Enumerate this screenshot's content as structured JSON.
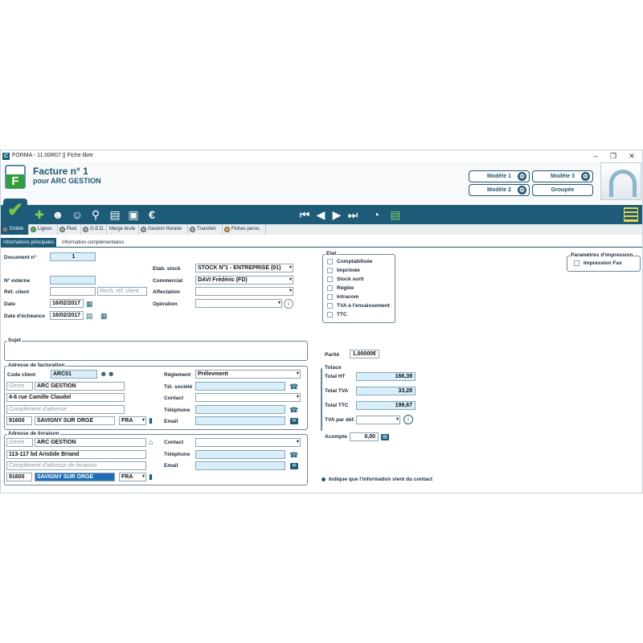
{
  "window": {
    "title": "FORMA - 11.00R07 || Fiche libre",
    "icon": "C"
  },
  "header": {
    "title": "Facture n° 1",
    "subtitle": "pour ARC GESTION",
    "logo_letter": "F"
  },
  "models": {
    "m1": "Modèle 1",
    "m2": "Modèle 2",
    "m3": "Modèle 3",
    "grouped": "Groupée"
  },
  "toolbar": {
    "euro": "€"
  },
  "tabs": [
    "Entête",
    "Lignes",
    "Pied",
    "G.E.D.",
    "Marge brute",
    "Gestion Horaire",
    "Transfert",
    "Fiches perso."
  ],
  "subtabs": [
    "Informations principales",
    "Information complémentaires"
  ],
  "form": {
    "document_label": "Document n°",
    "document_value": "1",
    "ext_label": "N° externe",
    "ext_value": "",
    "ref_label": "Réf. client",
    "ref_value": "",
    "ref_search_ph": "Rech. réf. client",
    "date_label": "Date",
    "date_value": "16/02/2017",
    "due_label": "Date d'échéance",
    "due_value": "16/02/2017",
    "stock_label": "Etab. stock",
    "stock_value": "STOCK N°1 - ENTREPRISE (01)",
    "commercial_label": "Commercial",
    "commercial_value": "DAVI Frédéric (FD)",
    "affect_label": "Affectation",
    "affect_value": "",
    "op_label": "Opération",
    "op_value": ""
  },
  "etat": {
    "title": "Etat",
    "items": [
      "Comptabilisée",
      "Imprimée",
      "Stock sorti",
      "Réglée",
      "Intracom",
      "TVA à l'encaissement",
      "TTC"
    ]
  },
  "print": {
    "title": "Paramètres d'impression",
    "fax": "Impression Fax"
  },
  "sujet": {
    "title": "Sujet"
  },
  "billing": {
    "title": "Adresse de facturation",
    "client_label": "Code client",
    "client_value": "ARC01",
    "genre_ph": "Genre",
    "name": "ARC GESTION",
    "street": "4-6 rue Camille Claudel",
    "complement_ph": "Complément d'adresse",
    "zip": "91600",
    "city": "SAVIGNY SUR ORGE",
    "country": "FRA",
    "reglement_label": "Règlement",
    "reglement_value": "Prélevment",
    "tel_soc_label": "Tél. société",
    "contact_label": "Contact",
    "tel_label": "Téléphone",
    "email_label": "Email"
  },
  "delivery": {
    "title": "Adresse de livraison",
    "genre_ph": "Genre",
    "name": "ARC GESTION",
    "street": "113-117 bd Aristide Briand",
    "complement_ph": "Complément d'adresse de livraison",
    "zip": "91600",
    "city": "SAVIGNY SUR ORGE",
    "country": "FRA",
    "contact_label": "Contact",
    "tel_label": "Téléphone",
    "email_label": "Email"
  },
  "parite": {
    "label": "Parité",
    "value": "1,00000€"
  },
  "totaux": {
    "title": "Totaux",
    "ht_label": "Total HT",
    "ht": "166,39",
    "tva_label": "Total TVA",
    "tva": "33,28",
    "ttc_label": "Total TTC",
    "ttc": "199,67",
    "tvadef_label": "TVA par déf.",
    "tvadef": ""
  },
  "acompte": {
    "label": "Acompte",
    "value": "0,00"
  },
  "note": "Indique que l'information vient du contact",
  "colors": {
    "primary": "#1d5b78",
    "field_blue": "#d9eef9",
    "green": "#2f9e3b"
  }
}
